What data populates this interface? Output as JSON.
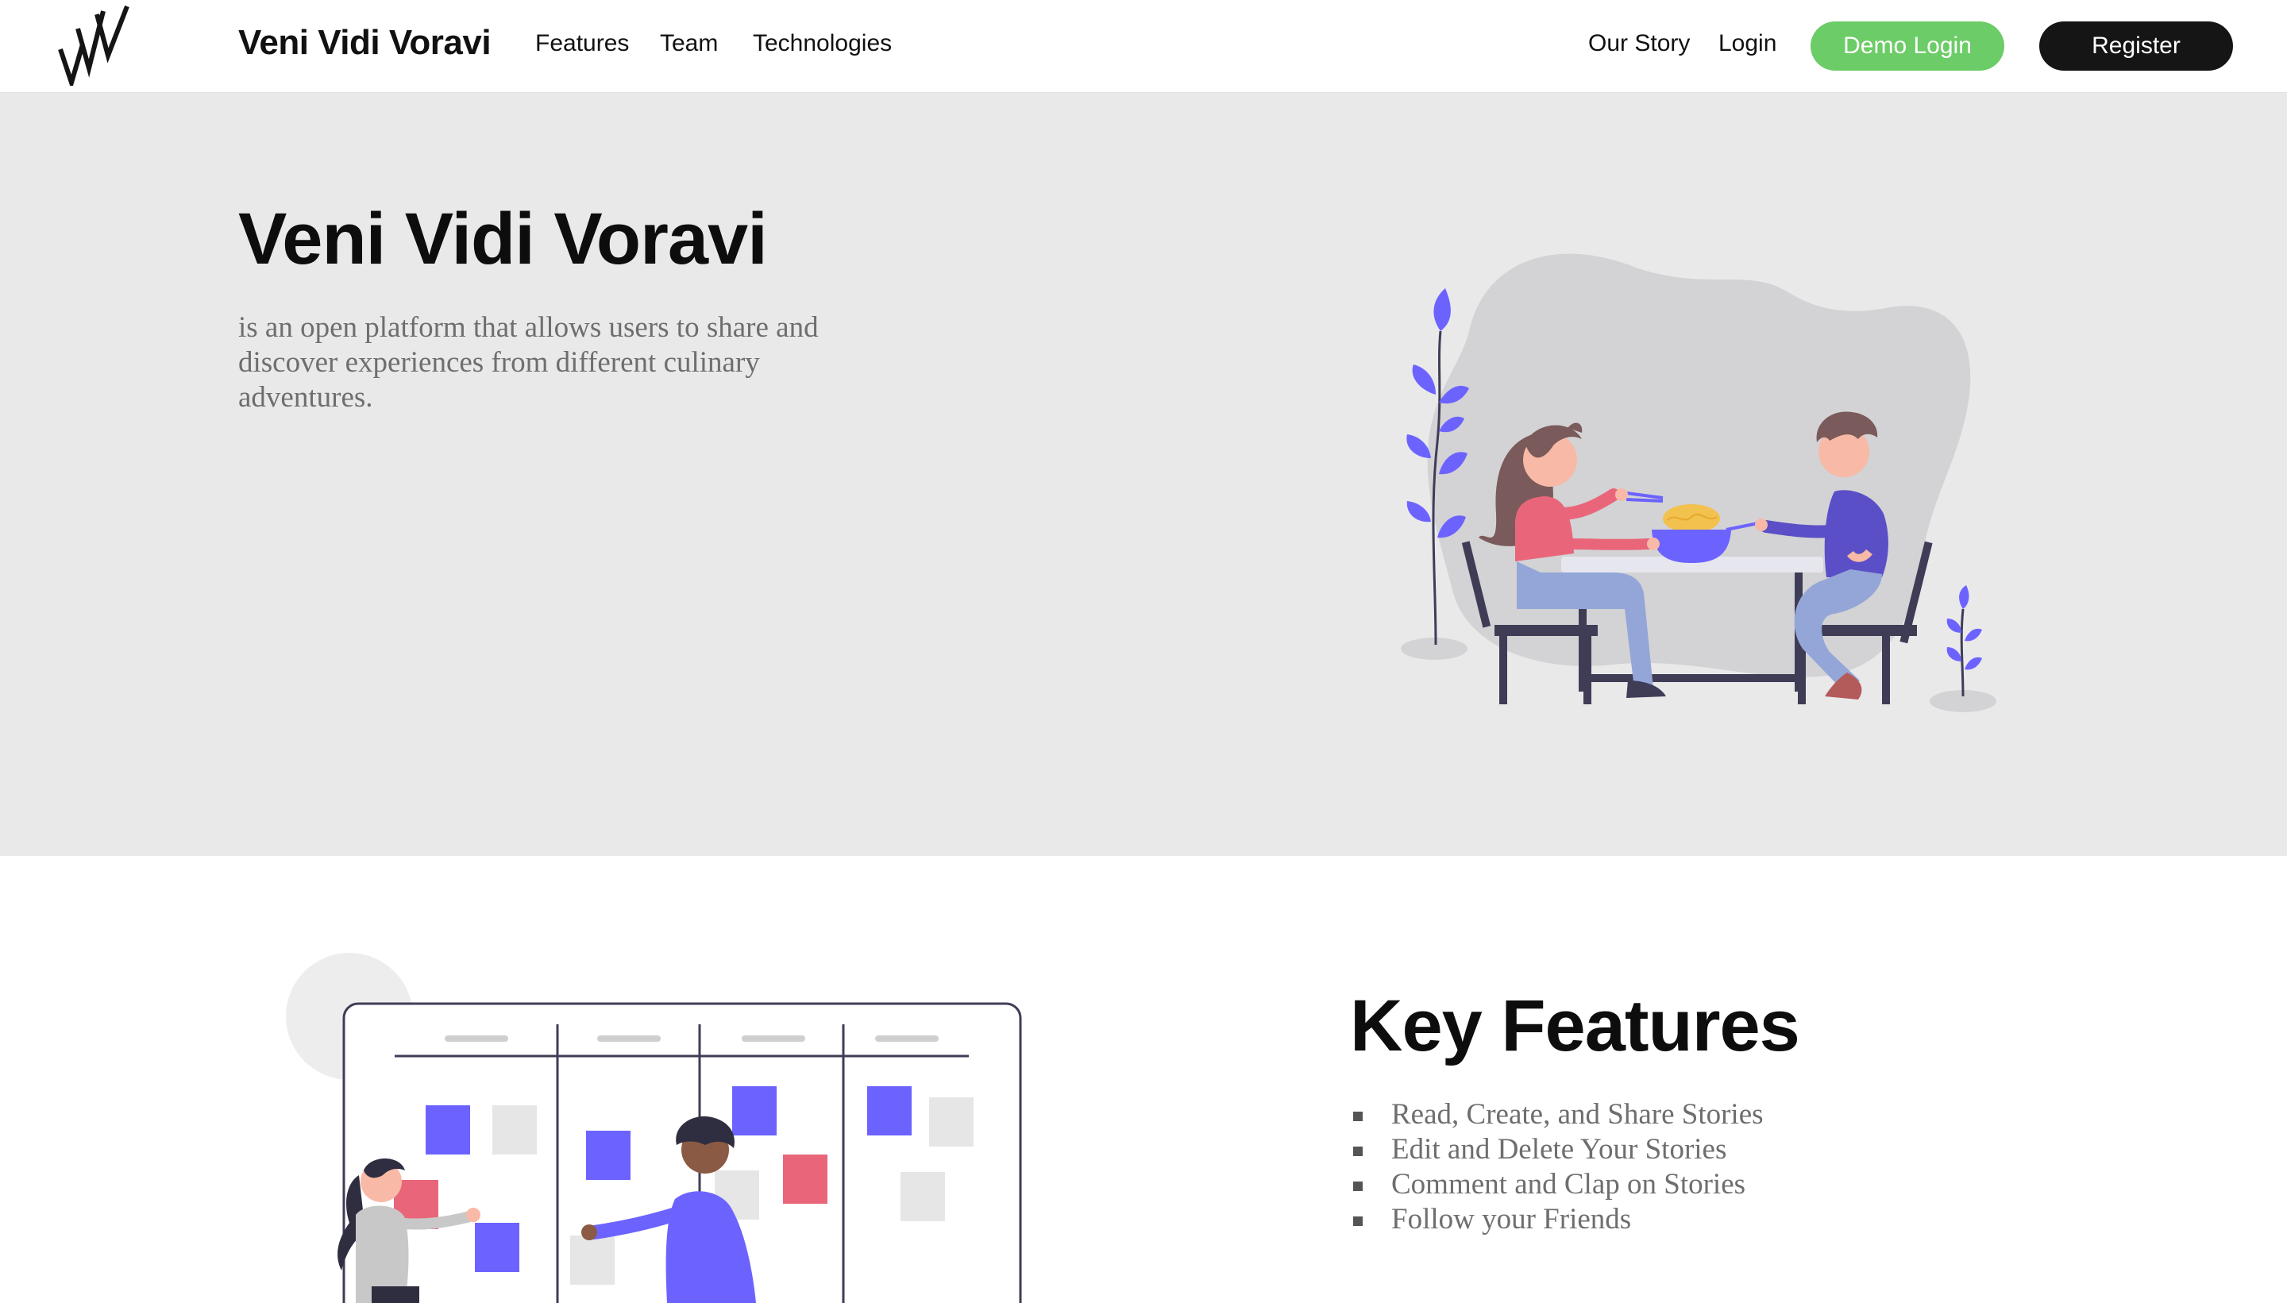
{
  "nav": {
    "logo": "vvv-logo",
    "brand": "Veni Vidi Voravi",
    "links": [
      "Features",
      "Team",
      "Technologies"
    ],
    "our_story": "Our Story",
    "login": "Login",
    "demo_login": "Demo Login",
    "register": "Register"
  },
  "hero": {
    "title": "Veni Vidi Voravi",
    "description": "is an open platform that allows users to share and discover experiences from different culinary adventures.",
    "illustration": "couple-dining-illustration"
  },
  "features": {
    "illustration": "kanban-board-illustration",
    "title": "Key Features",
    "items": [
      "Read, Create, and Share Stories",
      "Edit and Delete Your Stories",
      "Comment and Clap on Stories",
      "Follow your Friends"
    ]
  },
  "colors": {
    "demo_button": "#6ccc67",
    "register_button": "#151515",
    "hero_background": "#e9e9ea",
    "accent_purple": "#6c63ff",
    "accent_pink": "#e9667a"
  }
}
